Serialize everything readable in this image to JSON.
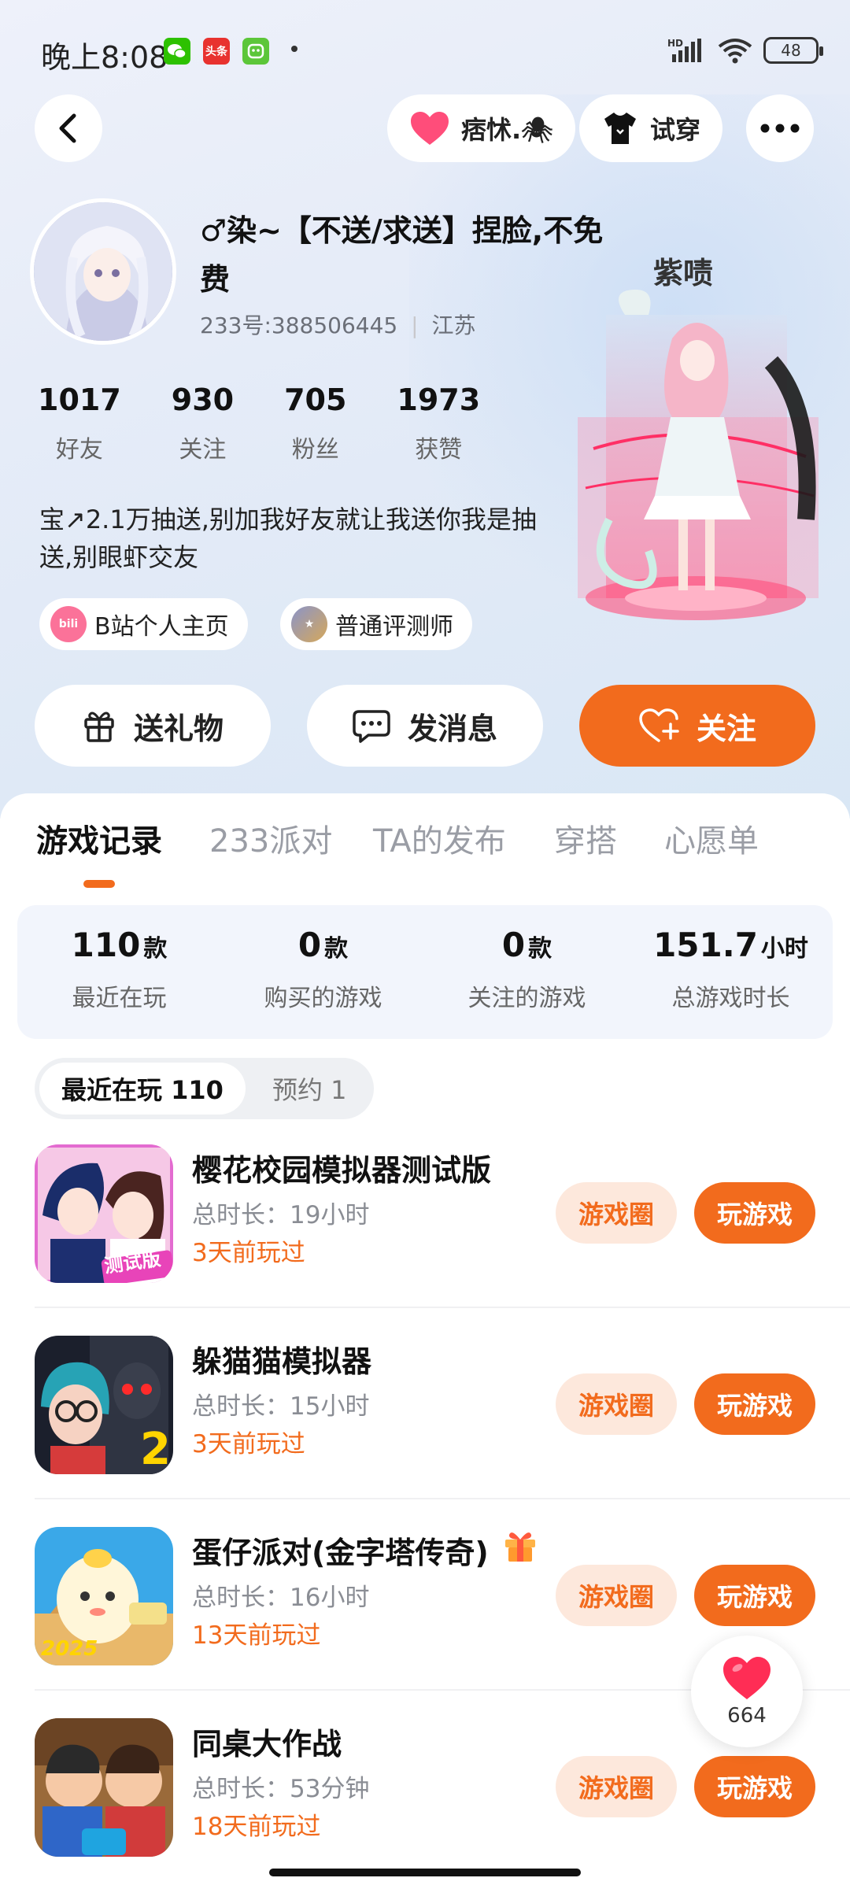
{
  "status_bar": {
    "time": "晚上8:08",
    "notif_icons": [
      "wechat-icon",
      "toutiao-icon",
      "app-icon"
    ],
    "battery": "48"
  },
  "top_nav": {
    "mood_label": "痞怵.🕷",
    "try_on_label": "试穿"
  },
  "profile": {
    "nickname": "♂染~【不送/求送】捏脸,不免费",
    "id_text": "233号:388506445",
    "location": "江苏",
    "stats": [
      {
        "value": "1017",
        "label": "好友"
      },
      {
        "value": "930",
        "label": "关注"
      },
      {
        "value": "705",
        "label": "粉丝"
      },
      {
        "value": "1973",
        "label": "获赞"
      }
    ],
    "bio": "宝↗2.1万抽送,别加我好友就让我送你我是抽送,别眼虾交友",
    "tags": [
      {
        "label": "B站个人主页",
        "icon": "bilibili-icon"
      },
      {
        "label": "普通评测师",
        "icon": "reviewer-badge-icon"
      }
    ],
    "character_caption": "紫啧"
  },
  "actions": {
    "gift": "送礼物",
    "message": "发消息",
    "follow": "关注"
  },
  "tabs": [
    "游戏记录",
    "233派对",
    "TA的发布",
    "穿搭",
    "心愿单"
  ],
  "summary": [
    {
      "value": "110",
      "unit": "款",
      "label": "最近在玩"
    },
    {
      "value": "0",
      "unit": "款",
      "label": "购买的游戏"
    },
    {
      "value": "0",
      "unit": "款",
      "label": "关注的游戏"
    },
    {
      "value": "151.7",
      "unit": "小时",
      "label": "总游戏时长"
    }
  ],
  "segments": {
    "recent": "最近在玩 110",
    "reserve": "预约 1"
  },
  "games": [
    {
      "name": "樱花校园模拟器测试版",
      "duration": "总时长：19小时",
      "last": "3天前玩过",
      "icon_badge": "测试版"
    },
    {
      "name": "躲猫猫模拟器",
      "duration": "总时长：15小时",
      "last": "3天前玩过",
      "icon_badge": "2"
    },
    {
      "name": "蛋仔派对(金字塔传奇)",
      "duration": "总时长：16小时",
      "last": "13天前玩过",
      "icon_badge": "2025"
    },
    {
      "name": "同桌大作战",
      "duration": "总时长：53分钟",
      "last": "18天前玩过",
      "icon_badge": ""
    }
  ],
  "game_buttons": {
    "circle": "游戏圈",
    "play": "玩游戏"
  },
  "like_float": {
    "count": "664"
  },
  "colors": {
    "accent": "#f26b1d",
    "accent_soft": "#fde8dc"
  }
}
